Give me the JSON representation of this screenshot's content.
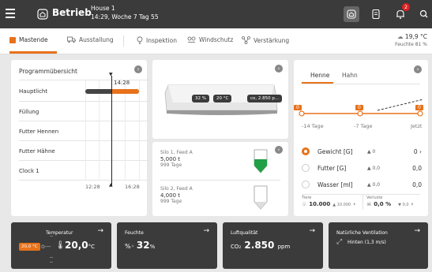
{
  "header": {
    "brand": "Betrieb",
    "house": "House 1",
    "datetime": "14:29, Woche 7 Tag 55",
    "notification_count": "2"
  },
  "subnav": {
    "items": [
      "Mastende",
      "Ausstallung",
      "Inspektion",
      "Windschutz",
      "Verstärkung"
    ],
    "weather_temp": "19,9 °C",
    "weather_humidity": "Feuchte 81 %"
  },
  "program": {
    "title": "Programmübersicht",
    "rows": [
      "Hauptlicht",
      "Füllung",
      "Futter Hennen",
      "Futter Hähne",
      "Clock 1"
    ],
    "now_label": "14:28",
    "axis_start": "12:28",
    "axis_end": "16:28",
    "mainlight_progress": 0.5
  },
  "feeder": {
    "badge_1": "32 %",
    "badge_2": "20 °C",
    "badge_3": "co, 2.850 p..."
  },
  "silos": [
    {
      "name": "Silo 1, Feed A",
      "amount": "5,000 t",
      "days": "999 Tage",
      "fill": 0.45
    },
    {
      "name": "Silo 2, Feed A",
      "amount": "4,000 t",
      "days": "999 Tage",
      "fill": 0.0
    }
  ],
  "hen_panel": {
    "tab_henne": "Henne",
    "tab_hahn": "Hahn",
    "timeline_labels": [
      "-14 Tage",
      "-7 Tage",
      "Jetzt"
    ],
    "markers": [
      "0",
      "0",
      "0"
    ],
    "rows": [
      {
        "label": "Gewicht [G]",
        "delta": "▲ 0",
        "value": "0"
      },
      {
        "label": "Futter [G]",
        "delta": "▲ 0,0",
        "value": "0,0"
      },
      {
        "label": "Wasser [ml]",
        "delta": "▲ 0,0",
        "value": "0,0"
      }
    ],
    "animals_label": "Tiere",
    "animals_value": "10.000",
    "animals_delta": "▲ 10.000",
    "losses_label": "Verluste",
    "losses_value": "0,0 %",
    "losses_delta": "▼ 0,0"
  },
  "tiles": [
    {
      "title": "Temperatur",
      "value": "20,0",
      "unit": "°C",
      "setpoint": "20,0 °C"
    },
    {
      "title": "Feuchte",
      "value": "32",
      "unit": "%"
    },
    {
      "title": "Luftqualität",
      "value": "2.850",
      "unit": "ppm",
      "prefix": "CO₂"
    },
    {
      "title": "Natürliche Ventilation",
      "value": "Hinten (1,3 m/s)"
    }
  ],
  "colors": {
    "accent": "#e7721b",
    "dark": "#3b3b3b",
    "green": "#22a045"
  }
}
